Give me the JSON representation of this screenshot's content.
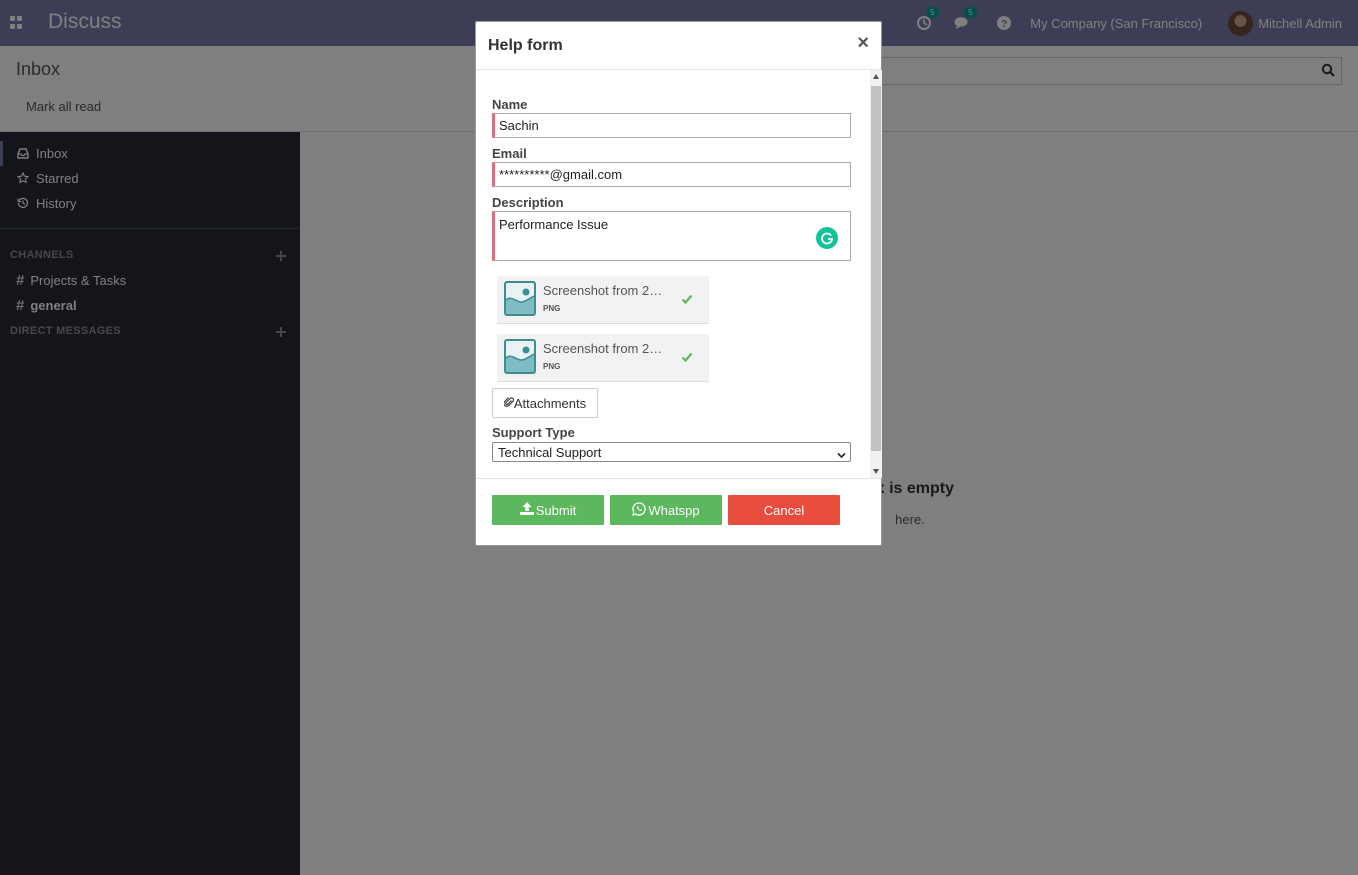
{
  "navbar": {
    "app_name": "Discuss",
    "activity_count": "5",
    "messages_count": "5",
    "company": "My Company (San Francisco)",
    "user": "Mitchell Admin"
  },
  "control_panel": {
    "breadcrumb": "Inbox",
    "mark_all_read": "Mark all read"
  },
  "sidebar": {
    "items": [
      {
        "label": "Inbox",
        "icon": "inbox-icon"
      },
      {
        "label": "Starred",
        "icon": "star-icon"
      },
      {
        "label": "History",
        "icon": "history-icon"
      }
    ],
    "channels_header": "CHANNELS",
    "channels": [
      {
        "label": "Projects & Tasks"
      },
      {
        "label": "general"
      }
    ],
    "direct_messages_header": "DIRECT MESSAGES"
  },
  "main": {
    "empty_title": "ox is empty",
    "empty_sub": "here."
  },
  "modal": {
    "title": "Help form",
    "close": "×",
    "name_label": "Name",
    "name_value": "Sachin",
    "email_label": "Email",
    "email_value": "**********@gmail.com",
    "description_label": "Description",
    "description_value": "Performance Issue",
    "attachments": [
      {
        "name": "Screenshot from 2…",
        "ext": "PNG"
      },
      {
        "name": "Screenshot from 2…",
        "ext": "PNG"
      }
    ],
    "attachments_button": "Attachments",
    "support_type_label": "Support Type",
    "support_type_value": "Technical Support",
    "submit": "Submit",
    "whatsapp": "Whatspp",
    "cancel": "Cancel"
  },
  "colors": {
    "navbar": "#7c7bad",
    "sidebar": "#262a36",
    "required_border": "#d9707f",
    "button_green": "#5cb85c",
    "button_red": "#e74c3c",
    "grammarly": "#15c39a"
  }
}
